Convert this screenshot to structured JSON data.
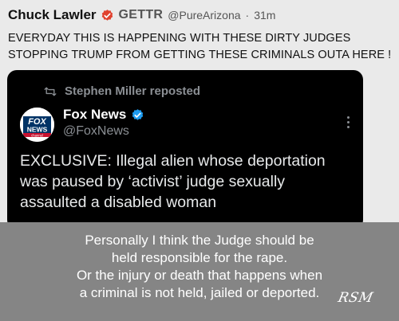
{
  "post": {
    "author": "Chuck Lawler",
    "platform": "GETTR",
    "handle": "@PureArizona",
    "separator": "·",
    "time": "31m",
    "text_line1": "EVERYDAY THIS IS HAPPENING WITH THESE DIRTY JUDGES",
    "text_line2": "STOPPING TRUMP FROM GETTING THESE CRIMINALS OUTA HERE !",
    "badge_color": "#e0422f"
  },
  "embed": {
    "repost_label": "Stephen Miller reposted",
    "source_name": "Fox News",
    "source_handle": "@FoxNews",
    "logo_text_top": "FOX",
    "logo_text_middle": "NEWS",
    "logo_text_bottom": "channel",
    "verified_color": "#1d9bf0",
    "headline_line1": "EXCLUSIVE: Illegal alien whose deportation",
    "headline_line2": "was paused by ‘activist’ judge sexually",
    "headline_line3": "assaulted a disabled woman",
    "icons": [
      "repost-icon",
      "verified-badge-icon",
      "more-options-icon"
    ]
  },
  "caption": {
    "line1": "Personally I think the Judge should be",
    "line2": "held responsible for the rape.",
    "line3": "Or the injury or death that happens when",
    "line4": "a criminal is not held, jailed or deported.",
    "signature": "RSM"
  }
}
